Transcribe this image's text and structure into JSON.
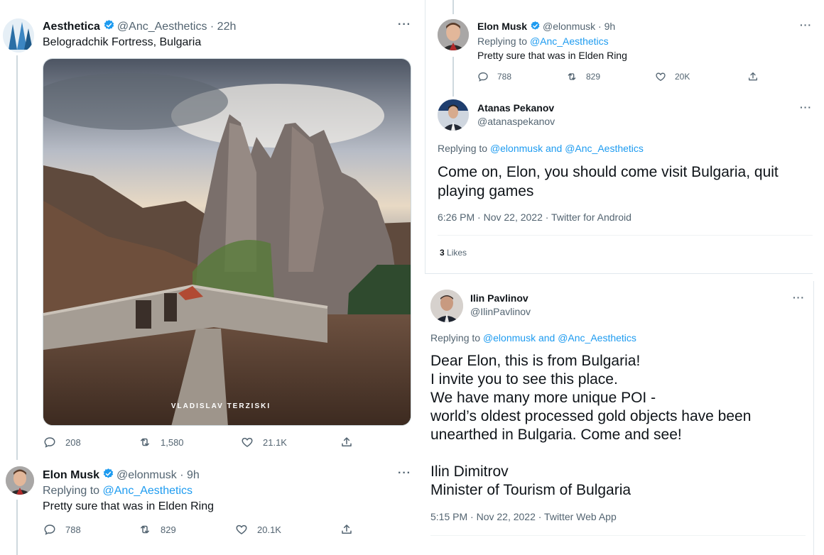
{
  "tweet1": {
    "name": "Aesthetica",
    "handle": "@Anc_Aesthetics",
    "time": "· 22h",
    "text": "Belogradchik Fortress, Bulgaria",
    "image_watermark": "VLADISLAV TERZISKI",
    "replies": "208",
    "retweets": "1,580",
    "likes": "21.1K"
  },
  "tweet2": {
    "name": "Elon Musk",
    "handle": "@elonmusk",
    "time": "· 9h",
    "replying_label": "Replying to",
    "replying_to": "@Anc_Aesthetics",
    "text": "Pretty sure that was in Elden Ring",
    "replies": "788",
    "retweets": "829",
    "likes": "20.1K"
  },
  "tweet3": {
    "name": "Elon Musk",
    "handle": "@elonmusk",
    "time": "· 9h",
    "replying_label": "Replying to",
    "replying_to": "@Anc_Aesthetics",
    "text": "Pretty sure that was in Elden Ring",
    "replies": "788",
    "retweets": "829",
    "likes": "20K"
  },
  "tweet4": {
    "name": "Atanas Pekanov",
    "handle": "@atanaspekanov",
    "replying_label": "Replying to",
    "replying_to": "@elonmusk and @Anc_Aesthetics",
    "text": "Come on, Elon, you should come visit Bulgaria, quit playing games",
    "meta": "6:26 PM · Nov 22, 2022 · Twitter for Android",
    "likes_count": "3",
    "likes_label": "Likes"
  },
  "tweet5": {
    "name": "Ilin Pavlinov",
    "handle": "@IlinPavlinov",
    "replying_label": "Replying to",
    "replying_to": "@elonmusk and @Anc_Aesthetics",
    "lines": [
      "Dear Elon, this is from Bulgaria!",
      "I invite you to see this place.",
      "We have many more unique POI -",
      "world’s oldest processed gold objects have been",
      "unearthed in Bulgaria. Come and see!",
      "",
      "Ilin Dimitrov",
      "Minister of Tourism of Bulgaria"
    ],
    "meta": "5:15 PM · Nov 22, 2022 · Twitter Web App"
  },
  "icons": [
    "reply-icon",
    "retweet-icon",
    "like-icon",
    "share-icon",
    "verified-icon",
    "more-icon"
  ],
  "colors": {
    "brand_blue": "#1d9bf0",
    "muted": "#536471",
    "text": "#0f1419",
    "line": "#cfd9de"
  }
}
